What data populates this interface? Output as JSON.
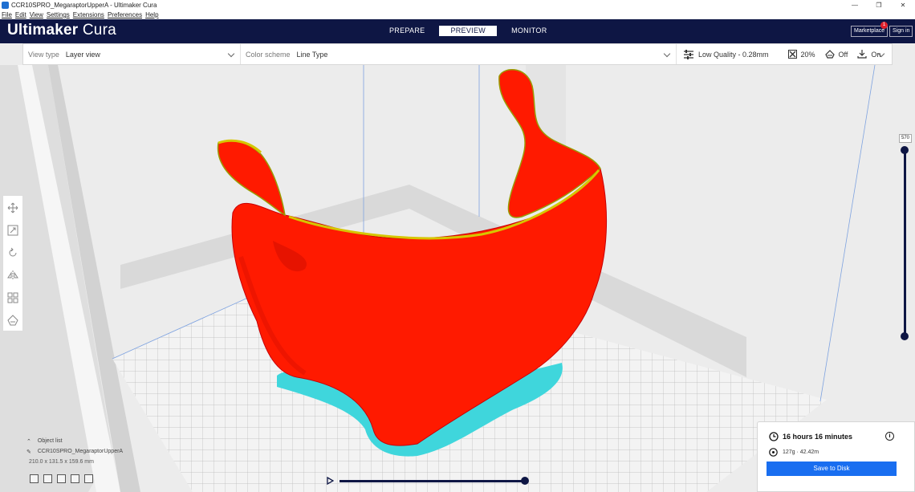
{
  "window": {
    "title": "CCR10SPRO_MegaraptorUpperA - Ultimaker Cura",
    "controls": [
      "—",
      "❐",
      "✕"
    ]
  },
  "menu": [
    "File",
    "Edit",
    "View",
    "Settings",
    "Extensions",
    "Preferences",
    "Help"
  ],
  "header": {
    "brand_bold": "Ultimaker",
    "brand_light": "Cura",
    "stages": [
      "PREPARE",
      "PREVIEW",
      "MONITOR"
    ],
    "active_stage": "PREVIEW",
    "marketplace": "Marketplace",
    "marketplace_badge": "1",
    "sign_in": "Sign in"
  },
  "toolbar": {
    "view_type_label": "View type",
    "view_type_value": "Layer view",
    "color_scheme_label": "Color scheme",
    "color_scheme_value": "Line Type",
    "quality": "Low Quality - 0.28mm",
    "infill": "20%",
    "support": "Off",
    "adhesion": "On"
  },
  "layer_slider": {
    "value": "570"
  },
  "object_list": {
    "label": "Object list",
    "object_name": "CCR10SPRO_MegaraptorUpperA",
    "dimensions": "210.0 x 131.5 x 159.6 mm"
  },
  "print_panel": {
    "time": "16 hours 16 minutes",
    "material": "127g · 42.42m",
    "save_button": "Save to Disk"
  },
  "colors": {
    "header_bg": "#0e1644",
    "model_red": "#ff1a00",
    "brim_cyan": "#3fd6dc",
    "accent_blue": "#196ef0"
  },
  "icons": {
    "tools": [
      "move-icon",
      "scale-icon",
      "rotate-icon",
      "mirror-icon",
      "per-model-settings-icon",
      "support-blocker-icon"
    ]
  }
}
